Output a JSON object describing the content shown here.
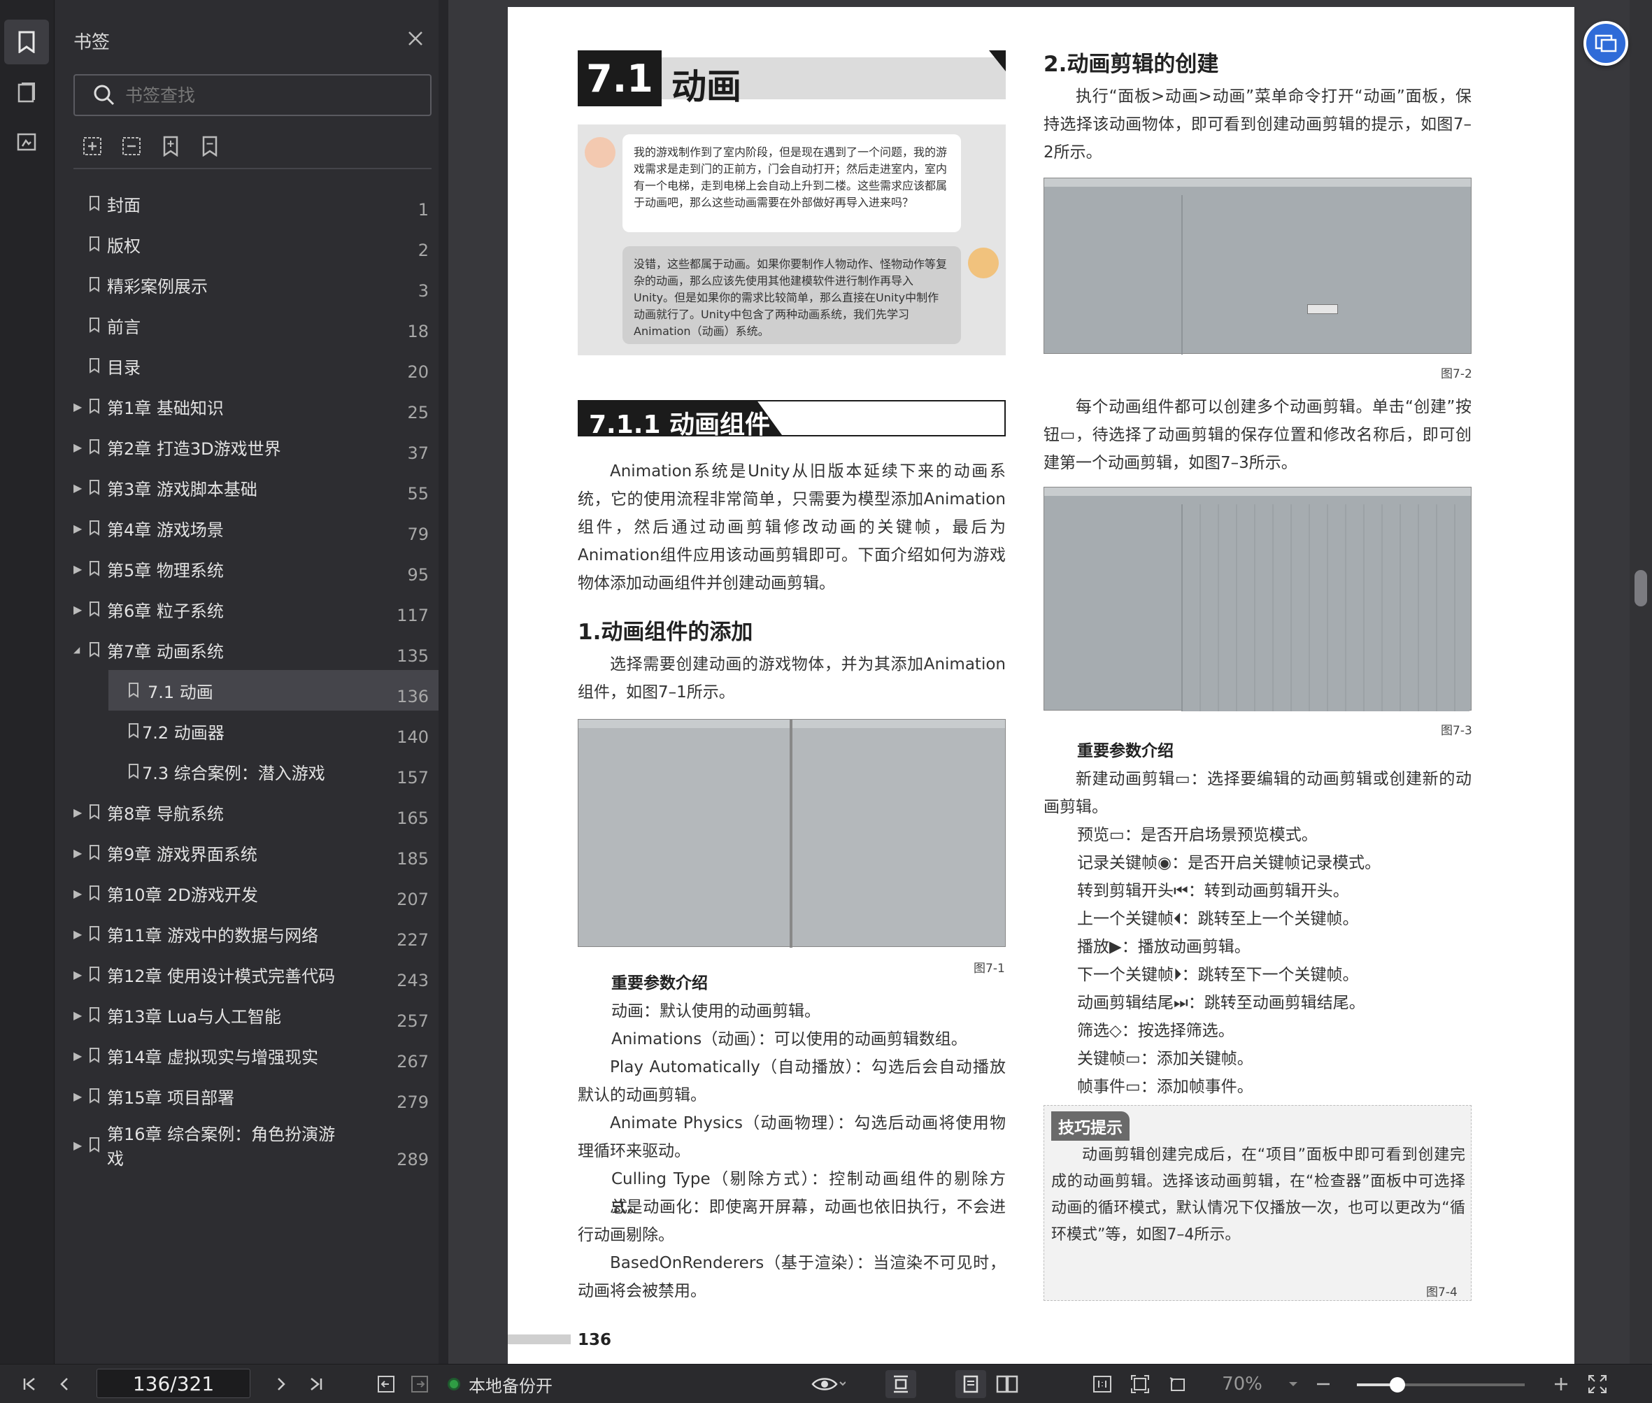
{
  "sidebar": {
    "title": "书签",
    "search_placeholder": "书签查找",
    "items": [
      {
        "label": "封面",
        "page": "1",
        "level": 0,
        "expander": "none"
      },
      {
        "label": "版权",
        "page": "2",
        "level": 0,
        "expander": "none"
      },
      {
        "label": "精彩案例展示",
        "page": "3",
        "level": 0,
        "expander": "none"
      },
      {
        "label": "前言",
        "page": "18",
        "level": 0,
        "expander": "none"
      },
      {
        "label": "目录",
        "page": "20",
        "level": 0,
        "expander": "none"
      },
      {
        "label": "第1章 基础知识",
        "page": "25",
        "level": 0,
        "expander": "collapsed"
      },
      {
        "label": "第2章 打造3D游戏世界",
        "page": "37",
        "level": 0,
        "expander": "collapsed"
      },
      {
        "label": "第3章 游戏脚本基础",
        "page": "55",
        "level": 0,
        "expander": "collapsed"
      },
      {
        "label": "第4章 游戏场景",
        "page": "79",
        "level": 0,
        "expander": "collapsed"
      },
      {
        "label": "第5章 物理系统",
        "page": "95",
        "level": 0,
        "expander": "collapsed"
      },
      {
        "label": "第6章 粒子系统",
        "page": "117",
        "level": 0,
        "expander": "collapsed"
      },
      {
        "label": "第7章 动画系统",
        "page": "135",
        "level": 0,
        "expander": "expanded"
      },
      {
        "label": "7.1 动画",
        "page": "136",
        "level": 1,
        "expander": "none",
        "selected": true
      },
      {
        "label": "7.2 动画器",
        "page": "140",
        "level": 1,
        "expander": "none"
      },
      {
        "label": "7.3 综合案例：潜入游戏",
        "page": "157",
        "level": 1,
        "expander": "none"
      },
      {
        "label": "第8章 导航系统",
        "page": "165",
        "level": 0,
        "expander": "collapsed"
      },
      {
        "label": "第9章 游戏界面系统",
        "page": "185",
        "level": 0,
        "expander": "collapsed"
      },
      {
        "label": "第10章 2D游戏开发",
        "page": "207",
        "level": 0,
        "expander": "collapsed"
      },
      {
        "label": "第11章 游戏中的数据与网络",
        "page": "227",
        "level": 0,
        "expander": "collapsed"
      },
      {
        "label": "第12章 使用设计模式完善代码",
        "page": "243",
        "level": 0,
        "expander": "collapsed"
      },
      {
        "label": "第13章 Lua与人工智能",
        "page": "257",
        "level": 0,
        "expander": "collapsed"
      },
      {
        "label": "第14章 虚拟现实与增强现实",
        "page": "267",
        "level": 0,
        "expander": "collapsed"
      },
      {
        "label": "第15章 项目部署",
        "page": "279",
        "level": 0,
        "expander": "collapsed"
      },
      {
        "label": "第16章 综合案例：角色扮演游",
        "label2": "戏",
        "page": "289",
        "level": 0,
        "expander": "collapsed"
      }
    ]
  },
  "page": {
    "section_number": "7.1",
    "section_title": "动画",
    "dialog_q": "我的游戏制作到了室内阶段，但是现在遇到了一个问题，我的游戏需求是走到门的正前方，门会自动打开；然后走进室内，室内有一个电梯，走到电梯上会自动上升到二楼。这些需求应该都属于动画吧，那么这些动画需要在外部做好再导入进来吗？",
    "dialog_a": "没错，这些都属于动画。如果你要制作人物动作、怪物动作等复杂的动画，那么应该先使用其他建模软件进行制作再导入Unity。但是如果你的需求比较简单，那么直接在Unity中制作动画就行了。Unity中包含了两种动画系统，我们先学习Animation（动画）系统。",
    "sub_number": "7.1.1",
    "sub_title": "动画组件",
    "intro": "Animation系统是Unity从旧版本延续下来的动画系统，它的使用流程非常简单，只需要为模型添加Animation组件，然后通过动画剪辑修改动画的关键帧，最后为Animation组件应用该动画剪辑即可。下面介绍如何为游戏物体添加动画组件并创建动画剪辑。",
    "h_add": "1.动画组件的添加",
    "add_text": "选择需要创建动画的游戏物体，并为其添加Animation组件，如图7–1所示。",
    "fig1": "图7-1",
    "params_title": "重要参数介绍",
    "p_anim": "动画：默认使用的动画剪辑。",
    "p_anims": "Animations（动画）：可以使用的动画剪辑数组。",
    "p_play": "Play Automatically（自动播放）：勾选后会自动播放默认的动画剪辑。",
    "p_phys": "Animate Physics（动画物理）：勾选后动画将使用物理循环来驱动。",
    "p_cull": "Culling Type（剔除方式）：控制动画组件的剔除方式。",
    "p_always": "总是动画化：即使离开屏幕，动画也依旧执行，不会进行动画剔除。",
    "p_based": "BasedOnRenderers（基于渲染）：当渲染不可见时，动画将会被禁用。",
    "h_create": "2.动画剪辑的创建",
    "create_text": "执行“面板>动画>动画”菜单命令打开“动画”面板，保持选择该动画物体，即可看到创建动画剪辑的提示，如图7–2所示。",
    "fig2": "图7-2",
    "create_text2": "每个动画组件都可以创建多个动画剪辑。单击“创建”按钮▭，待选择了动画剪辑的保存位置和修改名称后，即可创建第一个动画剪辑，如图7–3所示。",
    "fig3": "图7-3",
    "params2_title": "重要参数介绍",
    "r_new": "新建动画剪辑▭：选择要编辑的动画剪辑或创建新的动画剪辑。",
    "r_preview": "预览▭：是否开启场景预览模式。",
    "r_record": "记录关键帧◉：是否开启关键帧记录模式。",
    "r_start": "转到剪辑开头⏮：转到动画剪辑开头。",
    "r_prev": "上一个关键帧⏴：跳转至上一个关键帧。",
    "r_play": "播放▶：播放动画剪辑。",
    "r_next": "下一个关键帧⏵：跳转至下一个关键帧。",
    "r_end": "动画剪辑结尾⏭：跳转至动画剪辑结尾。",
    "r_filter": "筛选◇：按选择筛选。",
    "r_key": "关键帧▭：添加关键帧。",
    "r_event": "帧事件▭：添加帧事件。",
    "tip_tag": "技巧提示",
    "tip_text": "动画剪辑创建完成后，在“项目”面板中即可看到创建完成的动画剪辑。选择该动画剪辑，在“检查器”面板中可选择动画的循环模式，默认情况下仅播放一次，也可以更改为“循环模式”等，如图7–4所示。",
    "fig4": "图7-4",
    "page_number": "136"
  },
  "bottombar": {
    "page_indicator": "136/321",
    "backup_status": "本地备份开",
    "zoom": "70%",
    "zoom_fraction": 0.24
  },
  "colors": {
    "accent_blue": "#2f6bd8",
    "status_green": "#2f9e44",
    "selected_row": "#45454b"
  }
}
